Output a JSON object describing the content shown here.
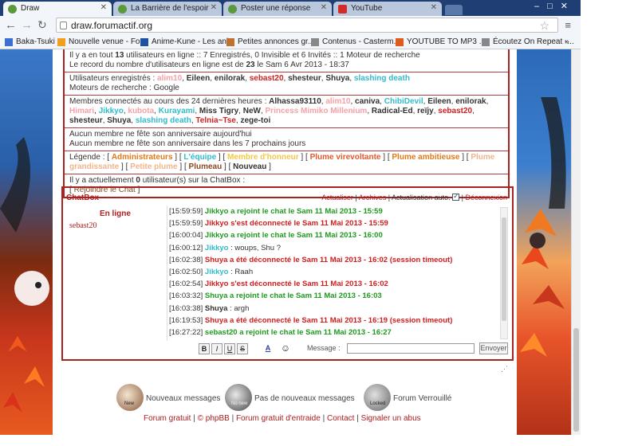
{
  "browser": {
    "tabs": [
      {
        "title": "Draw",
        "active": true,
        "favicon_color": "#5a9a3a"
      },
      {
        "title": "La Barrière de l'espoir",
        "active": false,
        "favicon_color": "#5a9a3a"
      },
      {
        "title": "Poster une réponse",
        "active": false,
        "favicon_color": "#5a9a3a"
      },
      {
        "title": "YouTube",
        "active": false,
        "favicon_color": "#d42a2a"
      }
    ],
    "url": "draw.forumactif.org",
    "bookmarks": [
      {
        "label": "Baka-Tsuki",
        "icon_color": "#3b6fd4"
      },
      {
        "label": "Nouvelle venue - Fo...",
        "icon_color": "#f0a020"
      },
      {
        "label": "Anime-Kune - Les ani...",
        "icon_color": "#2050a0"
      },
      {
        "label": "Petites annonces gr...",
        "icon_color": "#c07030"
      },
      {
        "label": "Contenus - Casterm...",
        "icon_color": "#888888"
      },
      {
        "label": "YOUTUBE TO MP3 ...",
        "icon_color": "#e05a1a"
      },
      {
        "label": "Écoutez On Repeat -...",
        "icon_color": "#888888"
      }
    ],
    "bookmarks_more": "»"
  },
  "who_is_online": {
    "stats_line1_a": "Il y a en tout ",
    "total_users": "13",
    "stats_line1_b": " utilisateurs en ligne :: 7 Enregistrés, 0 Invisible et 6 Invités :: 1 Moteur de recherche",
    "stats_line2_a": "Le record du nombre d'utilisateurs en ligne est de ",
    "record_users": "23",
    "stats_line2_b": " le Sam 6 Avr 2013 - 18:37",
    "registered_label": "Utilisateurs enregistrés : ",
    "registered_users": [
      {
        "name": "alim10",
        "color": "#f5a0a8"
      },
      {
        "name": "Eileen",
        "color": "#333333"
      },
      {
        "name": "enilorak",
        "color": "#333333"
      },
      {
        "name": "sebast20",
        "color": "#cc2222"
      },
      {
        "name": "shesteur",
        "color": "#333333"
      },
      {
        "name": "Shuya",
        "color": "#333333"
      },
      {
        "name": "slashing death",
        "color": "#33bbcc"
      }
    ],
    "search_engines_label": "Moteurs de recherche : ",
    "search_engine": "Google",
    "connected_24h_label": "Membres connectés au cours des 24 dernières heures : ",
    "connected_24h_users": [
      {
        "name": "Alhassa93110",
        "color": "#333333"
      },
      {
        "name": "alim10",
        "color": "#f5a0a8"
      },
      {
        "name": "caniva",
        "color": "#333333"
      },
      {
        "name": "ChibiDevil",
        "color": "#33bbcc"
      },
      {
        "name": "Eileen",
        "color": "#333333"
      },
      {
        "name": "enilorak",
        "color": "#333333"
      },
      {
        "name": "Himari",
        "color": "#f5a0a8"
      },
      {
        "name": "Jikkyo",
        "color": "#33bbcc"
      },
      {
        "name": "kubota",
        "color": "#f5a0a8"
      },
      {
        "name": "Kurayami",
        "color": "#33bbcc"
      },
      {
        "name": "Miss Tigry",
        "color": "#333333"
      },
      {
        "name": "NeW",
        "color": "#333333"
      },
      {
        "name": "Princess Mimiko Millenium",
        "color": "#f5a0a8"
      },
      {
        "name": "Radical-Ed",
        "color": "#333333"
      },
      {
        "name": "reïjy",
        "color": "#333333"
      },
      {
        "name": "sebast20",
        "color": "#cc2222"
      },
      {
        "name": "shesteur",
        "color": "#333333"
      },
      {
        "name": "Shuya",
        "color": "#333333"
      },
      {
        "name": "slashing death",
        "color": "#33bbcc"
      },
      {
        "name": "Telnia~Tse",
        "color": "#cc2222"
      },
      {
        "name": "zege-toi",
        "color": "#333333"
      }
    ],
    "no_birthday_today": "Aucun membre ne fête son anniversaire aujourd'hui",
    "no_birthday_week": "Aucun membre ne fête son anniversaire dans les 7 prochains jours",
    "legend_label": "Légende : ",
    "legend_groups": [
      {
        "name": "Administrateurs",
        "color": "#e07a1a"
      },
      {
        "name": "L'équipe",
        "color": "#33bbcc"
      },
      {
        "name": "Membre d'honneur",
        "color": "#f2c84a"
      },
      {
        "name": "Plume virevoltante",
        "color": "#e05a2a"
      },
      {
        "name": "Plume ambitieuse",
        "color": "#e07a1a"
      },
      {
        "name": "Plume grandissante",
        "color": "#f2b48a"
      },
      {
        "name": "Petite plume",
        "color": "#f2b48a"
      },
      {
        "name": "Plumeau",
        "color": "#8a4a20"
      },
      {
        "name": "Nouveau",
        "color": "#333333"
      }
    ],
    "chat_users_a": "Il y a actuellement ",
    "chat_users_count": "0",
    "chat_users_b": " utilisateur(s) sur la ChatBox :",
    "join_chat": "Rejoindre le Chat"
  },
  "chatbox": {
    "title": "ChatBox",
    "actualiser": "Actualiser",
    "archives": "Archives",
    "auto_refresh_label": "Actualisation auto.",
    "auto_refresh_checked": true,
    "deconnexion": "Déconnexion",
    "online_title": "En ligne",
    "online_users": [
      "sebast20"
    ],
    "messages": [
      {
        "time": "[15:59:59]",
        "kind": "join",
        "text": "Jikkyo a rejoint le chat le Sam 11 Mai 2013 - 15:59"
      },
      {
        "time": "[15:59:59]",
        "kind": "leave",
        "text": "Jikkyo s'est déconnecté le Sam 11 Mai 2013 - 15:59"
      },
      {
        "time": "[16:00:04]",
        "kind": "join",
        "text": "Jikkyo a rejoint le chat le Sam 11 Mai 2013 - 16:00"
      },
      {
        "time": "[16:00:12]",
        "kind": "say",
        "who": "Jikkyo",
        "who_color": "#33bbcc",
        "text": "woups, Shu ?"
      },
      {
        "time": "[16:02:38]",
        "kind": "leave",
        "text": "Shuya a été déconnecté le Sam 11 Mai 2013 - 16:02 (session timeout)"
      },
      {
        "time": "[16:02:50]",
        "kind": "say",
        "who": "Jikkyo",
        "who_color": "#33bbcc",
        "text": "Raah"
      },
      {
        "time": "[16:02:54]",
        "kind": "leave",
        "text": "Jikkyo s'est déconnecté le Sam 11 Mai 2013 - 16:02"
      },
      {
        "time": "[16:03:32]",
        "kind": "join",
        "text": "Shuya a rejoint le chat le Sam 11 Mai 2013 - 16:03"
      },
      {
        "time": "[16:03:38]",
        "kind": "say",
        "who": "Shuya",
        "who_color": "#333333",
        "text": "argh"
      },
      {
        "time": "[16:19:53]",
        "kind": "leave",
        "text": "Shuya a été déconnecté le Sam 11 Mai 2013 - 16:19 (session timeout)"
      },
      {
        "time": "[16:27:22]",
        "kind": "join",
        "text": "sebast20 a rejoint le chat le Sam 11 Mai 2013 - 16:27"
      }
    ],
    "format_buttons": [
      "B",
      "I",
      "U",
      "S"
    ],
    "color_button": "A",
    "smiley_button": "☺",
    "message_label": "Message :",
    "message_value": "",
    "send_label": "Envoyer"
  },
  "status_legend": [
    {
      "label": "Nouveaux messages",
      "icon_text": "New"
    },
    {
      "label": "Pas de nouveaux messages",
      "icon_text": "No new"
    },
    {
      "label": "Forum Verrouillé",
      "icon_text": "Locked"
    }
  ],
  "footer": {
    "forum_gratuit": "Forum gratuit",
    "phpbb": "© phpBB",
    "entraide": "Forum gratuit d'entraide",
    "contact": "Contact",
    "abuse": "Signaler un abus"
  }
}
